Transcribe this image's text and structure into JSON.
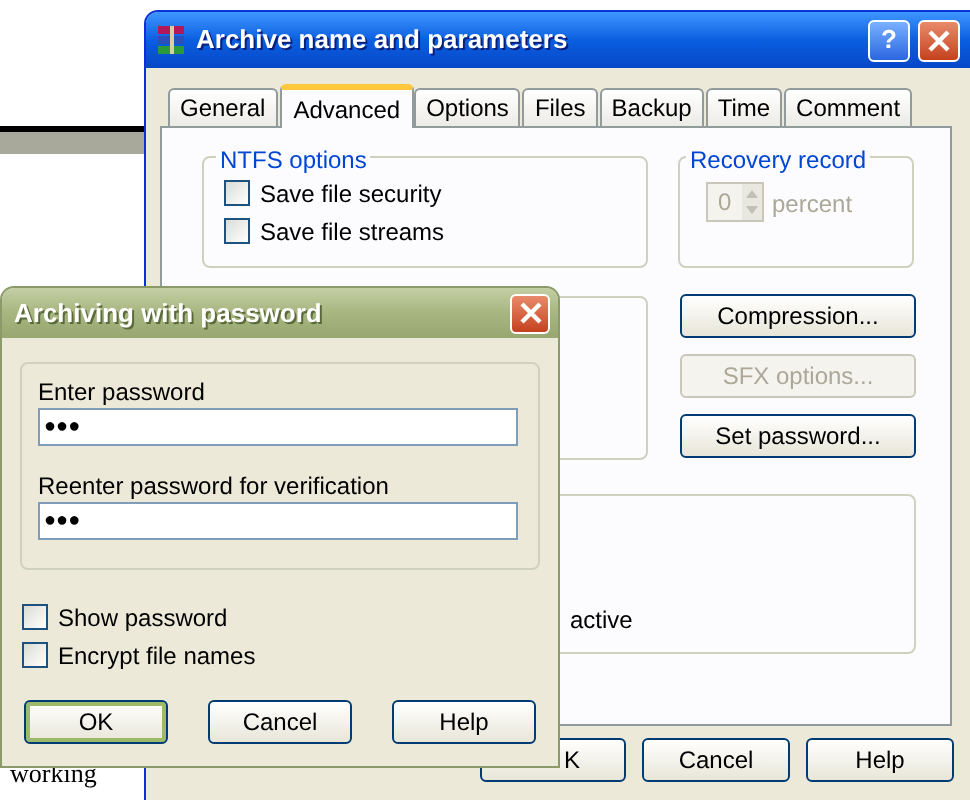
{
  "background_text": "working",
  "main_window": {
    "title": "Archive name and parameters",
    "tabs": [
      {
        "label": "General",
        "selected": false
      },
      {
        "label": "Advanced",
        "selected": true
      },
      {
        "label": "Options",
        "selected": false
      },
      {
        "label": "Files",
        "selected": false
      },
      {
        "label": "Backup",
        "selected": false
      },
      {
        "label": "Time",
        "selected": false
      },
      {
        "label": "Comment",
        "selected": false
      }
    ],
    "ntfs_options": {
      "title": "NTFS options",
      "checkboxes": [
        {
          "label": "Save file security",
          "checked": false
        },
        {
          "label": "Save file streams",
          "checked": false
        }
      ]
    },
    "recovery_record": {
      "title": "Recovery record",
      "value": "0",
      "unit": "percent",
      "disabled": true
    },
    "side_buttons": [
      {
        "label": "Compression...",
        "disabled": false
      },
      {
        "label": "SFX options...",
        "disabled": true
      },
      {
        "label": "Set password...",
        "disabled": false
      }
    ],
    "lower_group_text": "active",
    "help_button_label": "?",
    "buttons": [
      {
        "label": "K"
      },
      {
        "label": "Cancel"
      },
      {
        "label": "Help"
      }
    ]
  },
  "password_dialog": {
    "title": "Archiving with password",
    "fields": [
      {
        "label": "Enter password",
        "value": "●●●"
      },
      {
        "label": "Reenter password for verification",
        "value": "●●●"
      }
    ],
    "checkboxes": [
      {
        "label": "Show password",
        "checked": false
      },
      {
        "label": "Encrypt file names",
        "checked": false
      }
    ],
    "buttons": [
      {
        "label": "OK",
        "default": true
      },
      {
        "label": "Cancel",
        "default": false
      },
      {
        "label": "Help",
        "default": false
      }
    ]
  }
}
